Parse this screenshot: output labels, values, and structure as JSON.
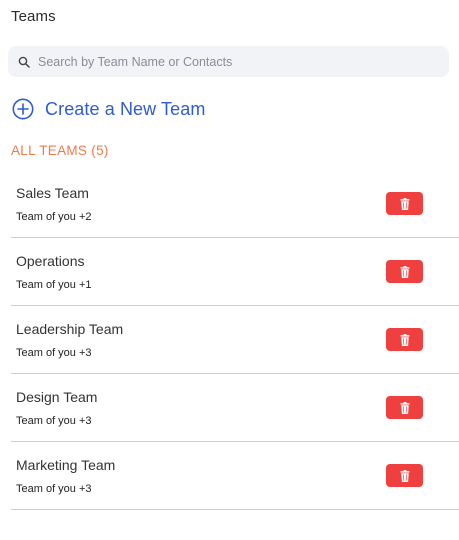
{
  "header": {
    "title": "Teams"
  },
  "search": {
    "placeholder": "Search by Team Name or Contacts",
    "icon": "search-icon"
  },
  "create": {
    "label": "Create a New Team",
    "icon": "plus-circle-icon",
    "color": "#2f5bd3"
  },
  "section": {
    "label": "ALL TEAMS (5)",
    "color": "#ef7a4d"
  },
  "teams": [
    {
      "name": "Sales Team",
      "members": "Team of you +2"
    },
    {
      "name": "Operations",
      "members": "Team of you +1"
    },
    {
      "name": "Leadership Team",
      "members": "Team of you +3"
    },
    {
      "name": "Design Team",
      "members": "Team of you +3"
    },
    {
      "name": "Marketing Team",
      "members": "Team of you +3"
    }
  ],
  "delete_button": {
    "icon": "trash-icon",
    "color": "#ef3f3f"
  }
}
